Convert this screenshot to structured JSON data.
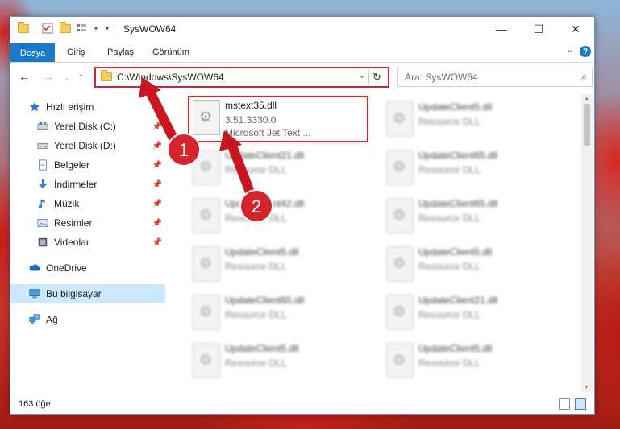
{
  "window": {
    "title": "SysWOW64",
    "controls": {
      "minimize": "—",
      "maximize": "☐",
      "close": "✕"
    }
  },
  "ribbon": {
    "tabs": [
      {
        "label": "Dosya",
        "active": true
      },
      {
        "label": "Giriş",
        "active": false
      },
      {
        "label": "Paylaş",
        "active": false
      },
      {
        "label": "Görünüm",
        "active": false
      }
    ],
    "help": "?"
  },
  "address": {
    "path": "C:\\Windows\\SysWOW64",
    "refresh_icon": "refresh-icon"
  },
  "search": {
    "placeholder": "Ara: SysWOW64"
  },
  "sidebar": {
    "items": [
      {
        "label": "Hızlı erişim",
        "icon": "star-icon",
        "pinned": false,
        "selected": false
      },
      {
        "label": "Yerel Disk (C:)",
        "icon": "drive-icon",
        "pinned": true,
        "selected": false
      },
      {
        "label": "Yerel Disk (D:)",
        "icon": "drive-icon",
        "pinned": true,
        "selected": false
      },
      {
        "label": "Belgeler",
        "icon": "documents-icon",
        "pinned": true,
        "selected": false
      },
      {
        "label": "İndirmeler",
        "icon": "download-icon",
        "pinned": true,
        "selected": false
      },
      {
        "label": "Müzik",
        "icon": "music-icon",
        "pinned": true,
        "selected": false
      },
      {
        "label": "Resimler",
        "icon": "pictures-icon",
        "pinned": true,
        "selected": false
      },
      {
        "label": "Videolar",
        "icon": "videos-icon",
        "pinned": true,
        "selected": false
      },
      {
        "label": "OneDrive",
        "icon": "cloud-icon",
        "pinned": false,
        "selected": false
      },
      {
        "label": "Bu bilgisayar",
        "icon": "computer-icon",
        "pinned": false,
        "selected": true
      },
      {
        "label": "Ağ",
        "icon": "network-icon",
        "pinned": false,
        "selected": false
      }
    ]
  },
  "files": {
    "highlighted": {
      "name": "mstext35.dll",
      "version": "3.51.3330.0",
      "description": "Microsoft Jet Text ..."
    },
    "tiles": [
      {
        "name": "UpdateClient5.dll",
        "type": "Resource DLL"
      },
      {
        "name": "UpdateClient21.dll",
        "type": "Resource DLL"
      },
      {
        "name": "UpdateClient65.dll",
        "type": "Resource DLL"
      },
      {
        "name": "UpdateClient42.dll",
        "type": "Resource DLL"
      },
      {
        "name": "UpdateClient65.dll",
        "type": "Resource DLL"
      },
      {
        "name": "UpdateClient5.dll",
        "type": "Resource DLL"
      },
      {
        "name": "UpdateClient5.dll",
        "type": "Resource DLL"
      },
      {
        "name": "UpdateClient65.dll",
        "type": "Resource DLL"
      },
      {
        "name": "UpdateClient21.dll",
        "type": "Resource DLL"
      },
      {
        "name": "UpdateClient5.dll",
        "type": "Resource DLL"
      },
      {
        "name": "UpdateClient5.dll",
        "type": "Resource DLL"
      }
    ]
  },
  "status": {
    "item_count": "163 öğe"
  },
  "annotations": {
    "badge1": "1",
    "badge2": "2",
    "color": "#d6242c"
  }
}
